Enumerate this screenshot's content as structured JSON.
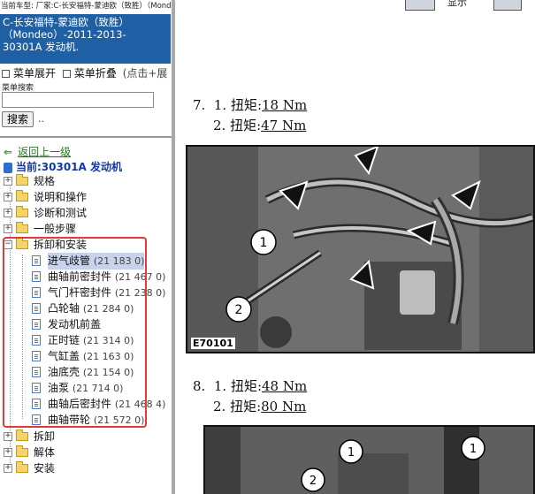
{
  "topbar": {
    "text": "当前车型:  厂家:C-长安福特-蒙迪欧（致胜）（Mondeo）2011-2013"
  },
  "title": "C-长安福特-蒙迪欧（致胜）（Mondeo）-2011-2013- 30301A 发动机.",
  "menu": {
    "expand_label": "菜单展开",
    "collapse_label": "菜单折叠",
    "hint": "(点击+展"
  },
  "search": {
    "label": "菜单搜索",
    "placeholder": "",
    "button": "搜索",
    "dots": ".."
  },
  "nav": {
    "back_label": "返回上一级",
    "current_label": "当前:30301A 发动机"
  },
  "tree": {
    "top_nodes": [
      {
        "label": "规格",
        "expander": "+"
      },
      {
        "label": "说明和操作",
        "expander": "+"
      },
      {
        "label": "诊断和测试",
        "expander": "+"
      },
      {
        "label": "一般步骤",
        "expander": "+"
      }
    ],
    "open_node": {
      "label": "拆卸和安装",
      "expander": "−"
    },
    "children": [
      {
        "label": "进气歧管",
        "code": "(21 183 0)",
        "selected": true
      },
      {
        "label": "曲轴前密封件",
        "code": "(21 467 0)"
      },
      {
        "label": "气门杆密封件",
        "code": "(21 238 0)"
      },
      {
        "label": "凸轮轴",
        "code": "(21 284 0)"
      },
      {
        "label": "发动机前盖",
        "code": ""
      },
      {
        "label": "正时链",
        "code": "(21 314 0)"
      },
      {
        "label": "气缸盖",
        "code": "(21 163 0)"
      },
      {
        "label": "油底壳",
        "code": "(21 154 0)"
      },
      {
        "label": "油泵",
        "code": "(21 714 0)"
      },
      {
        "label": "曲轴后密封件",
        "code": "(21 468 4)"
      },
      {
        "label": "曲轴带轮",
        "code": "(21 572 0)"
      }
    ],
    "bottom_nodes": [
      {
        "label": "拆卸",
        "expander": "+"
      },
      {
        "label": "解体",
        "expander": "+"
      },
      {
        "label": "安装",
        "expander": "+"
      }
    ]
  },
  "toolbar": {
    "label": "显示"
  },
  "content": {
    "step7": {
      "num": "7.",
      "line1_prefix": "1. 扭矩:",
      "line1_value": "18 Nm",
      "line2_prefix": "2. 扭矩:",
      "line2_value": "47 Nm"
    },
    "figure1": {
      "code": "E70101",
      "callout1": "1",
      "callout2": "2"
    },
    "step8": {
      "num": "8.",
      "line1_prefix": "1. 扭矩:",
      "line1_value": "48 Nm",
      "line2_prefix": "2. 扭矩:",
      "line2_value": "80 Nm"
    },
    "figure2": {
      "callout1": "1",
      "callout2": "2",
      "callout3": "1"
    }
  }
}
